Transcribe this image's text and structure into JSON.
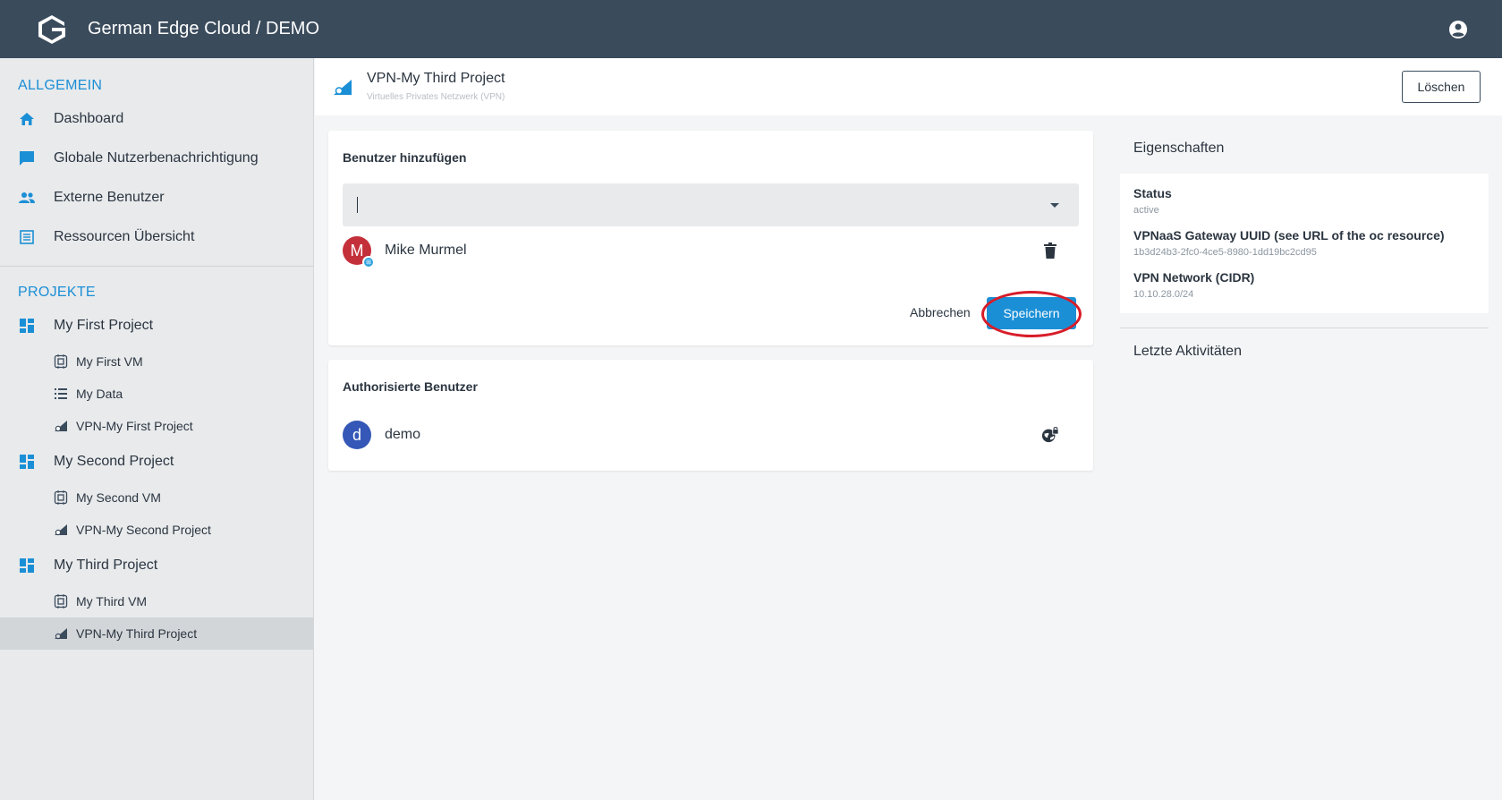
{
  "header": {
    "app_title": "German Edge Cloud / DEMO"
  },
  "sidebar": {
    "general_title": "ALLGEMEIN",
    "general_items": [
      {
        "label": "Dashboard",
        "icon": "home-icon"
      },
      {
        "label": "Globale Nutzerbenachrichtigung",
        "icon": "chat-icon"
      },
      {
        "label": "Externe Benutzer",
        "icon": "people-icon"
      },
      {
        "label": "Ressourcen Übersicht",
        "icon": "table-icon"
      }
    ],
    "projects_title": "PROJEKTE",
    "projects": [
      {
        "label": "My First Project",
        "vm": "My First VM",
        "data": "My Data",
        "vpn": "VPN-My First Project"
      },
      {
        "label": "My Second Project",
        "vm": "My Second VM",
        "vpn": "VPN-My Second Project"
      },
      {
        "label": "My Third Project",
        "vm": "My Third VM",
        "vpn": "VPN-My Third Project"
      }
    ]
  },
  "page": {
    "title": "VPN-My Third Project",
    "subtitle": "Virtuelles Privates Netzwerk (VPN)",
    "delete_label": "Löschen"
  },
  "add_users": {
    "title": "Benutzer hinzufügen",
    "select_value": "",
    "user_name": "Mike Murmel",
    "user_initial": "M",
    "cancel_label": "Abbrechen",
    "save_label": "Speichern"
  },
  "authorized_users": {
    "title": "Authorisierte Benutzer",
    "user_name": "demo",
    "user_initial": "d"
  },
  "properties": {
    "title": "Eigenschaften",
    "status_label": "Status",
    "status_value": "active",
    "uuid_label": "VPNaaS Gateway UUID (see URL of the oc resource)",
    "uuid_value": "1b3d24b3-2fc0-4ce5-8980-1dd19bc2cd95",
    "cidr_label": "VPN Network (CIDR)",
    "cidr_value": "10.10.28.0/24"
  },
  "activity": {
    "title": "Letzte Aktivitäten"
  },
  "colors": {
    "topbar": "#3a4b5c",
    "accent": "#1b8fd6",
    "highlight": "#d81d29"
  }
}
